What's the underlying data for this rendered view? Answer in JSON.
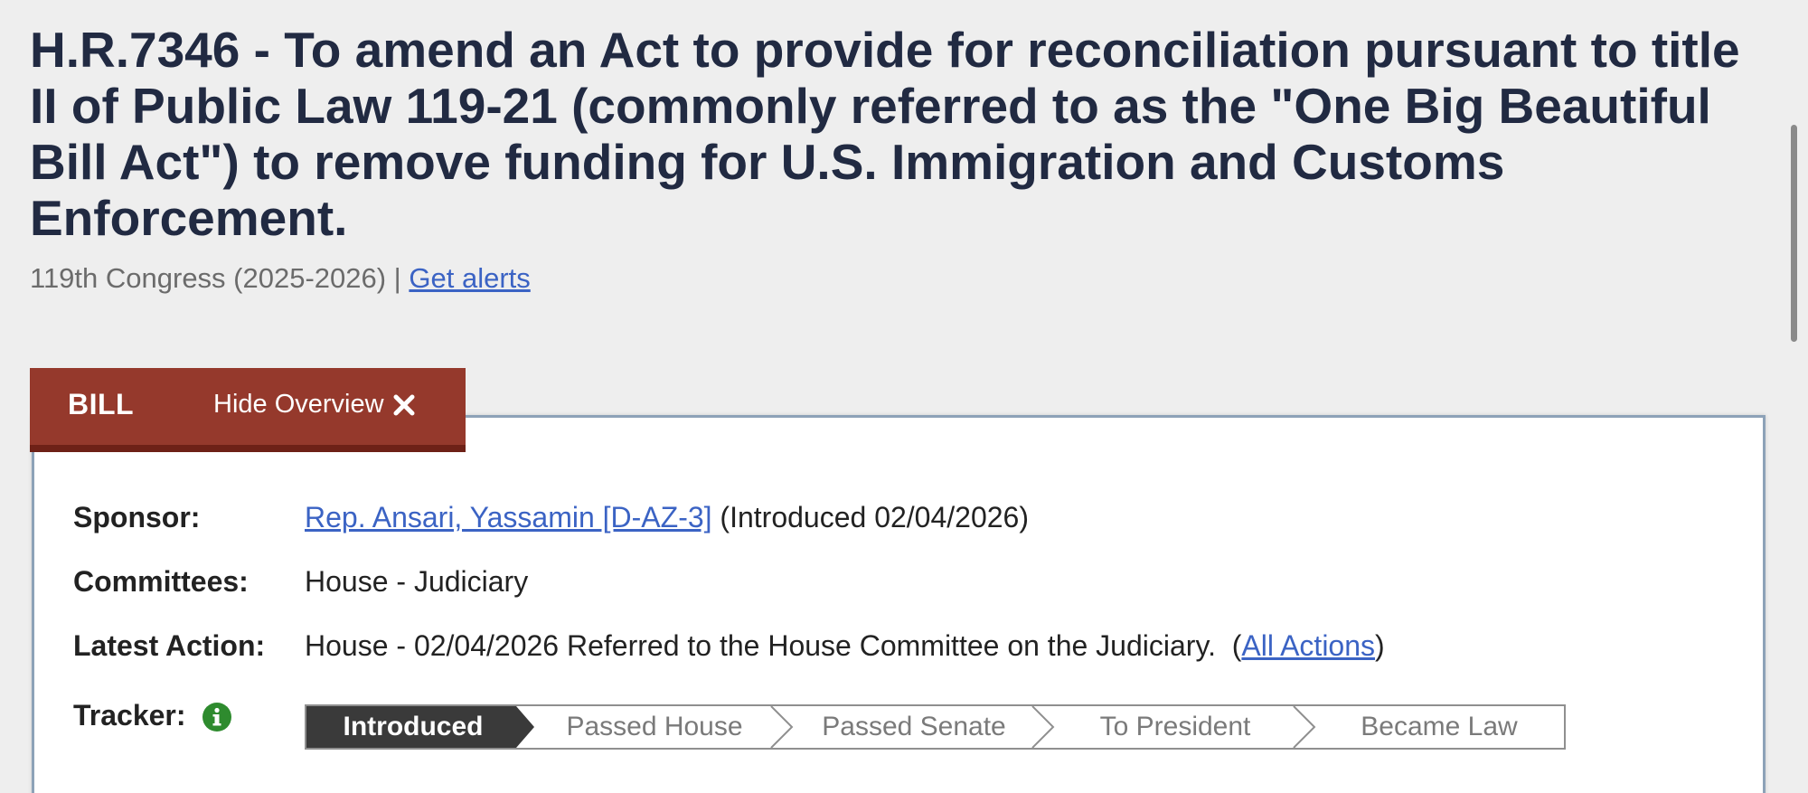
{
  "bill": {
    "title": "H.R.7346 - To amend an Act to provide for reconciliation pursuant to title II of Public Law 119-21 (commonly referred to as the \"One Big Beautiful Bill Act\") to remove funding for U.S. Immigration and Customs Enforcement.",
    "congress": "119th Congress (2025-2026) |",
    "alerts_link": "Get alerts"
  },
  "tab": {
    "label": "BILL",
    "hide_label": "Hide Overview",
    "hide_icon": "close-icon"
  },
  "overview": {
    "sponsor": {
      "label": "Sponsor:",
      "name": "Rep. Ansari, Yassamin [D-AZ-3]",
      "introduced": "(Introduced 02/04/2026)"
    },
    "committees": {
      "label": "Committees:",
      "value": "House - Judiciary"
    },
    "latest_action": {
      "label": "Latest Action:",
      "value": "House - 02/04/2026 Referred to the House Committee on the Judiciary.",
      "open_paren": "(",
      "link": "All Actions",
      "close_paren": ")"
    },
    "tracker": {
      "label": "Tracker:",
      "info_icon": "info-icon",
      "steps": [
        "Introduced",
        "Passed House",
        "Passed Senate",
        "To President",
        "Became Law"
      ],
      "active_step": "Introduced"
    }
  },
  "colors": {
    "title": "#212a42",
    "tab_background": "#95392c",
    "tab_border": "#6e2117",
    "link": "#3b63c4",
    "tracker_active": "#3a3a3a",
    "info_icon": "#2e8b2e"
  }
}
